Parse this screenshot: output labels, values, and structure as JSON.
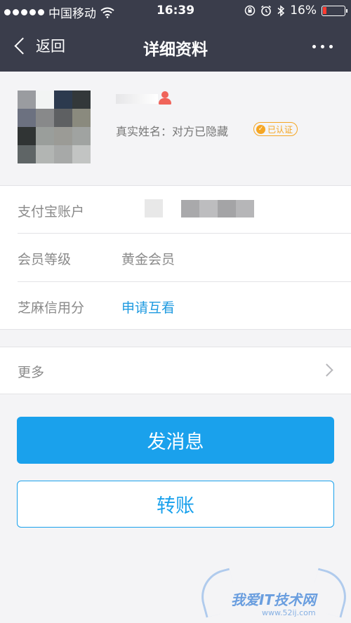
{
  "status_bar": {
    "carrier": "中国移动",
    "time": "16:39",
    "battery_percent": "16%",
    "icons": [
      "signal-dots-icon",
      "wifi-icon",
      "rotation-lock-icon",
      "alarm-icon",
      "bluetooth-icon",
      "battery-icon"
    ]
  },
  "nav": {
    "back_label": "返回",
    "title": "详细资料",
    "more_icon": "more-dots-icon"
  },
  "profile": {
    "real_name_text": "真实姓名：对方已隐藏",
    "verified_badge": "已认证",
    "gender_icon": "female-person-icon",
    "avatar_colors": [
      "#9a9ca0",
      "#f2f4f3",
      "#2c3a4e",
      "#33383a",
      "#6c7180",
      "#88898a",
      "#5e6062",
      "#8a8a7e",
      "#303434",
      "#9a9e9b",
      "#9b9b96",
      "#a0a3a1",
      "#5f6566",
      "#b2b5b3",
      "#a7a9a8",
      "#c2c4c3"
    ]
  },
  "info_rows": [
    {
      "label": "支付宝账户",
      "value": ""
    },
    {
      "label": "会员等级",
      "value": "黄金会员"
    },
    {
      "label": "芝麻信用分",
      "value": "申请互看"
    }
  ],
  "more": {
    "label": "更多"
  },
  "buttons": {
    "send_message": "发消息",
    "transfer": "转账"
  },
  "watermark": {
    "text": "我爱IT技术网",
    "url": "www.52ij.com"
  },
  "colors": {
    "header_bg": "#3a3d4b",
    "accent": "#1aa1ec",
    "badge": "#f5a623",
    "gender": "#f0645a"
  }
}
